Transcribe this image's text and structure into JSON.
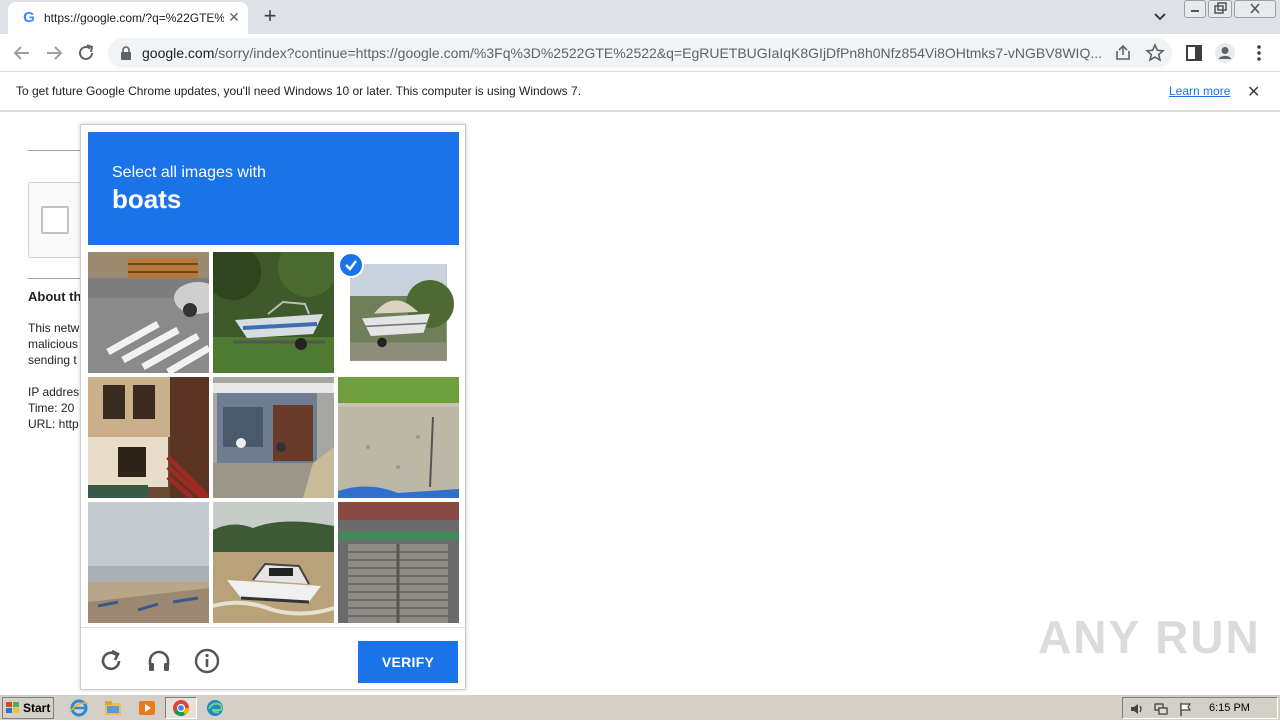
{
  "browser": {
    "tab_title": "https://google.com/?q=%22GTE%2",
    "favicon": "G",
    "url_host": "google.com",
    "url_rest": "/sorry/index?continue=https://google.com/%3Fq%3D%2522GTE%2522&q=EgRUETBUGIaIqK8GIjDfPn8h0Nfz854Vi8OHtmks7-vNGBV8WIQ..."
  },
  "infobar": {
    "message": "To get future Google Chrome updates, you'll need Windows 10 or later. This computer is using Windows 7.",
    "learn_more": "Learn more"
  },
  "page": {
    "about_heading": "About th",
    "text_lines": [
      "This netw",
      "malicious",
      "sending t",
      "",
      "IP addres",
      "Time: 20",
      "URL: http"
    ]
  },
  "challenge": {
    "instruction": "Select all images with",
    "object": "boats",
    "tiles": [
      {
        "scene": "street-crosswalk",
        "selected": false
      },
      {
        "scene": "boat-on-trailer",
        "selected": false
      },
      {
        "scene": "covered-boat",
        "selected": true
      },
      {
        "scene": "house-porch",
        "selected": false
      },
      {
        "scene": "shop-front",
        "selected": false
      },
      {
        "scene": "grass-road",
        "selected": false
      },
      {
        "scene": "beach",
        "selected": false
      },
      {
        "scene": "speedboat-river",
        "selected": false
      },
      {
        "scene": "shuttered-store",
        "selected": false
      }
    ],
    "verify_label": "VERIFY",
    "accent": "#1a73e8"
  },
  "watermark": "ANY RUN",
  "taskbar": {
    "start_label": "Start",
    "clock": "6:15 PM"
  }
}
